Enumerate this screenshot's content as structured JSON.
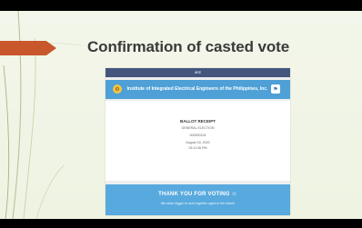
{
  "slide": {
    "title": "Confirmation of casted vote"
  },
  "screenshot": {
    "topbar_label": "IIEE",
    "organization_name": "Institute of Integrated Electrical Engineers of the Philippines, Inc.",
    "receipt": {
      "title": "BALLOT RECEIPT",
      "election_type": "GENERAL ELECTION",
      "receipt_number": "000000104",
      "date": "August 18, 2020",
      "time": "03:11:36 PM"
    },
    "thanks": {
      "message": "THANK YOU FOR VOTING ☺",
      "subtext": "We strive bigger to work together again in the future!"
    }
  },
  "colors": {
    "accent_arrow": "#c9572c",
    "topbar": "#44567e",
    "header_blue": "#4ea0d6",
    "thanks_blue": "#58aade"
  },
  "icons": {
    "left_logo": "iiee-logo-icon",
    "right_logo": "philippine-flag-icon"
  }
}
